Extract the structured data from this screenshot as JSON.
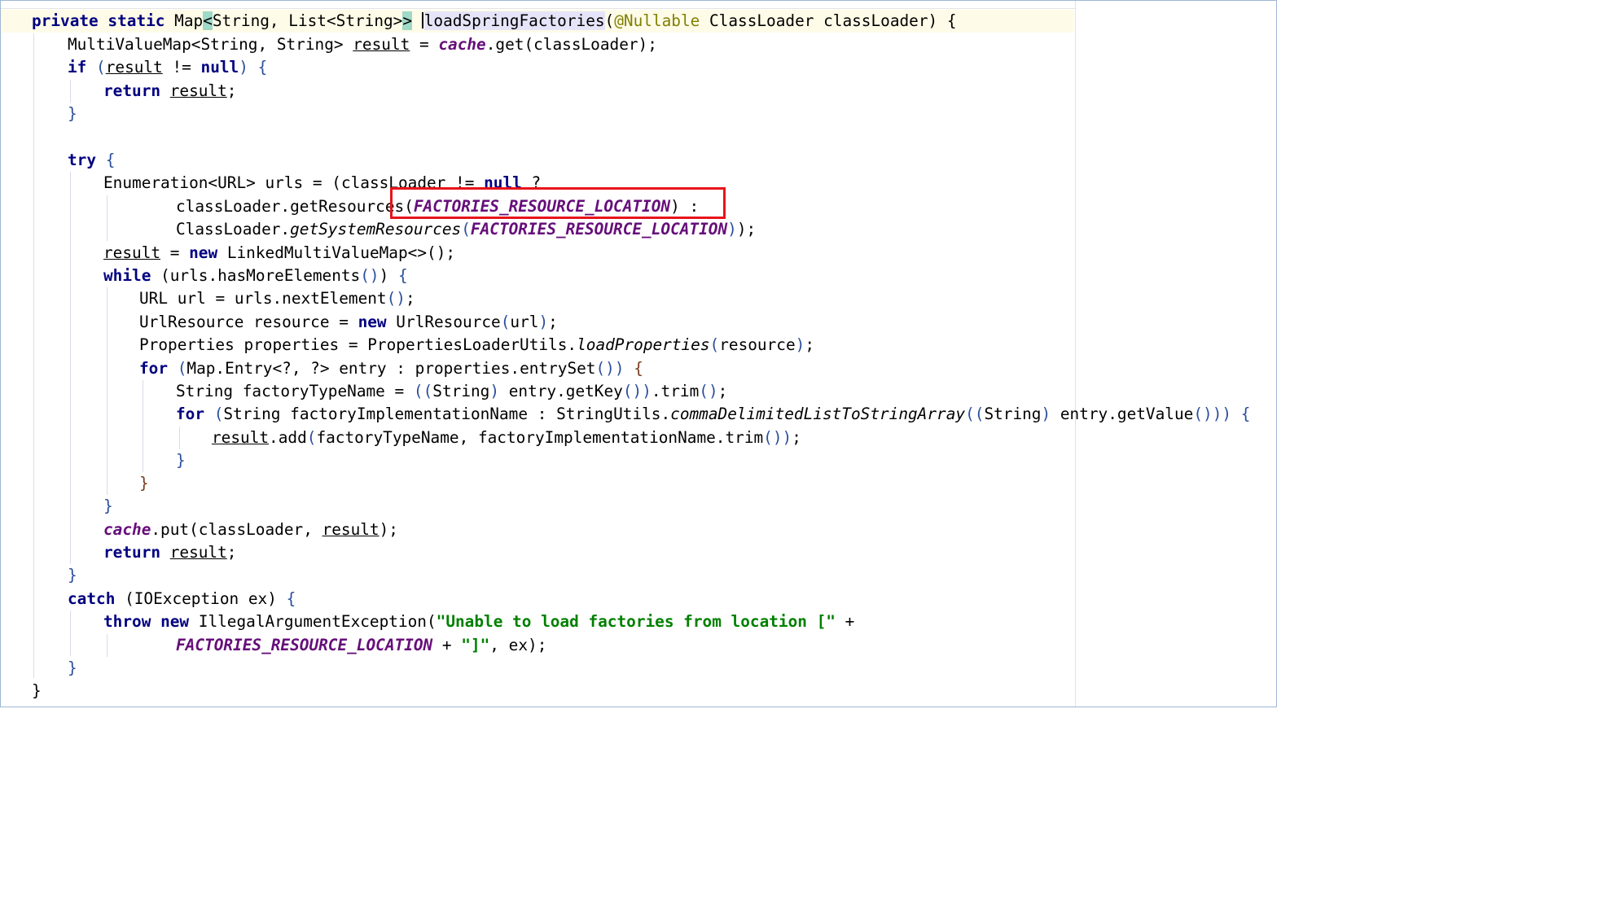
{
  "code": {
    "kw_private": "private",
    "kw_static": "static",
    "t_map": "Map",
    "lt": "<",
    "gt": ">",
    "t_string_list": "String, List<String>",
    "m_load": "loadSpringFactories",
    "ann_nullable": "@Nullable",
    "t_classloader": "ClassLoader",
    "p_classloader": "classLoader",
    "lparen": "(",
    "rparen": ")",
    "lbrace": "{",
    "rbrace": "}",
    "t_mvm": "MultiValueMap<String, String>",
    "v_result": "result",
    "op_assign": "=",
    "f_cache": "cache",
    "m_get": ".get",
    "semi": ";",
    "kw_if": "if",
    "op_neq": "!=",
    "kw_null": "null",
    "kw_return": "return",
    "kw_try": "try",
    "t_enum": "Enumeration<URL>",
    "v_urls": "urls",
    "q_mark": "?",
    "colon": ":",
    "m_getresources_call": "classLoader.getResources",
    "c_frl": "FACTORIES_RESOURCE_LOCATION",
    "cl_static": "ClassLoader.",
    "m_getsystemresources": "getSystemResources",
    "kw_new": "new",
    "t_lmvm": "LinkedMultiValueMap",
    "diamond": "<>",
    "kw_while": "while",
    "m_hasmore": "urls.hasMoreElements",
    "t_url": "URL",
    "v_url": "url",
    "m_nextelement": "urls.nextElement",
    "t_urlresource": "UrlResource",
    "v_resource": "resource",
    "t_properties": "Properties",
    "v_properties": "properties",
    "c_plu": "PropertiesLoaderUtils.",
    "m_loadproperties": "loadProperties",
    "kw_for": "for",
    "t_mapentry": "Map.Entry<?, ?>",
    "v_entry": "entry",
    "m_entryset": "properties.entrySet",
    "t_string": "String",
    "v_ftn": "factoryTypeName",
    "m_getkey": "entry.getKey",
    "m_trim": ".trim",
    "v_fin": "factoryImplementationName",
    "c_stringutils": "StringUtils.",
    "m_cdl": "commaDelimitedListToStringArray",
    "m_getvalue": "entry.getValue",
    "m_add": ".add",
    "comma": ",",
    "m_ftn_trim": "factoryImplementationName.trim",
    "m_put": ".put",
    "kw_catch": "catch",
    "t_ioexception": "IOException",
    "v_ex": "ex",
    "kw_throw": "throw",
    "t_iae": "IllegalArgumentException",
    "s_unable": "\"Unable to load factories from location [\"",
    "op_plus": "+",
    "s_rbracket": "\"]\""
  }
}
